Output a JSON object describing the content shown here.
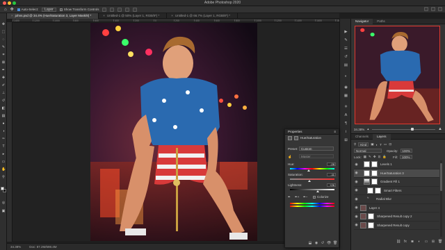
{
  "app": {
    "title": "Adobe Photoshop 2020"
  },
  "colors": {
    "window_close": "#ff5f57",
    "window_minimize": "#febc2e",
    "window_zoom": "#28c840",
    "selection_accent": "#4a8cd8",
    "navigator_view_box": "#e03a2e"
  },
  "options_bar": {
    "auto_select_label": "Auto-Select:",
    "auto_select_value": "Layer",
    "show_transform_label": "Show Transform Controls"
  },
  "document_tabs": [
    {
      "label": "johns.psd @ 34.4% (Hue/Saturation 3, Layer Mask/8) *"
    },
    {
      "label": "Untitled-1 @ 50% (Layer 1, RGB/8*) *"
    },
    {
      "label": "Untitled-1 @ 66.7% (Layer 1, RGB/8*) *"
    }
  ],
  "ruler_ticks": [
    "1400",
    "1200",
    "1000",
    "800",
    "600",
    "400",
    "200",
    "0",
    "200",
    "400",
    "600",
    "800",
    "1000",
    "1200",
    "1400",
    "1600",
    "1800",
    "2000"
  ],
  "status": {
    "zoom": "34.38%",
    "doc_size": "Doc: 87.2M/698.4M"
  },
  "navigator": {
    "tabs": [
      "Navigator",
      "Paths"
    ],
    "zoom": "34.38%",
    "zoom_fraction": 0.62
  },
  "layers_panel": {
    "tabs": [
      "Channels",
      "Layers"
    ],
    "filter_label": "Kind",
    "blend_mode": "Normal",
    "opacity_label": "Opacity:",
    "opacity_value": "100%",
    "lock_label": "Lock:",
    "fill_label": "Fill:",
    "fill_value": "100%",
    "layers": [
      {
        "name": "Levels 1",
        "icon": "levels-icon",
        "has_mask": true,
        "selected": false,
        "indent": 1
      },
      {
        "name": "Hue/Saturation 3",
        "icon": "hue-saturation-icon",
        "has_mask": true,
        "selected": true,
        "indent": 1
      },
      {
        "name": "Gradient Fill 1",
        "icon": "gradient-icon",
        "has_mask": true,
        "selected": false,
        "indent": 1
      },
      {
        "name": "Smart Filters",
        "icon": "smart-filter-icon",
        "has_mask": true,
        "selected": false,
        "indent": 2
      },
      {
        "name": "Radial Blur",
        "icon": "filter-icon",
        "has_mask": false,
        "selected": false,
        "indent": 2
      },
      {
        "name": "Layer 4",
        "icon": "pixel-layer-icon",
        "has_mask": false,
        "selected": false,
        "indent": 0
      },
      {
        "name": "Sharpened Result copy 2",
        "icon": "pixel-layer-icon",
        "has_mask": true,
        "selected": false,
        "indent": 0
      },
      {
        "name": "Sharpened Result copy",
        "icon": "pixel-layer-icon",
        "has_mask": true,
        "selected": false,
        "indent": 0
      }
    ]
  },
  "properties": {
    "title": "Properties",
    "subtitle": "Hue/Saturation",
    "preset_label": "Preset:",
    "preset_value": "Custom",
    "channel_value": "Master",
    "hue_label": "Hue:",
    "hue_value": "-28",
    "saturation_label": "Saturation:",
    "saturation_value": "-11",
    "lightness_label": "Lightness:",
    "lightness_value": "+26",
    "colorize_label": "Colorize"
  }
}
